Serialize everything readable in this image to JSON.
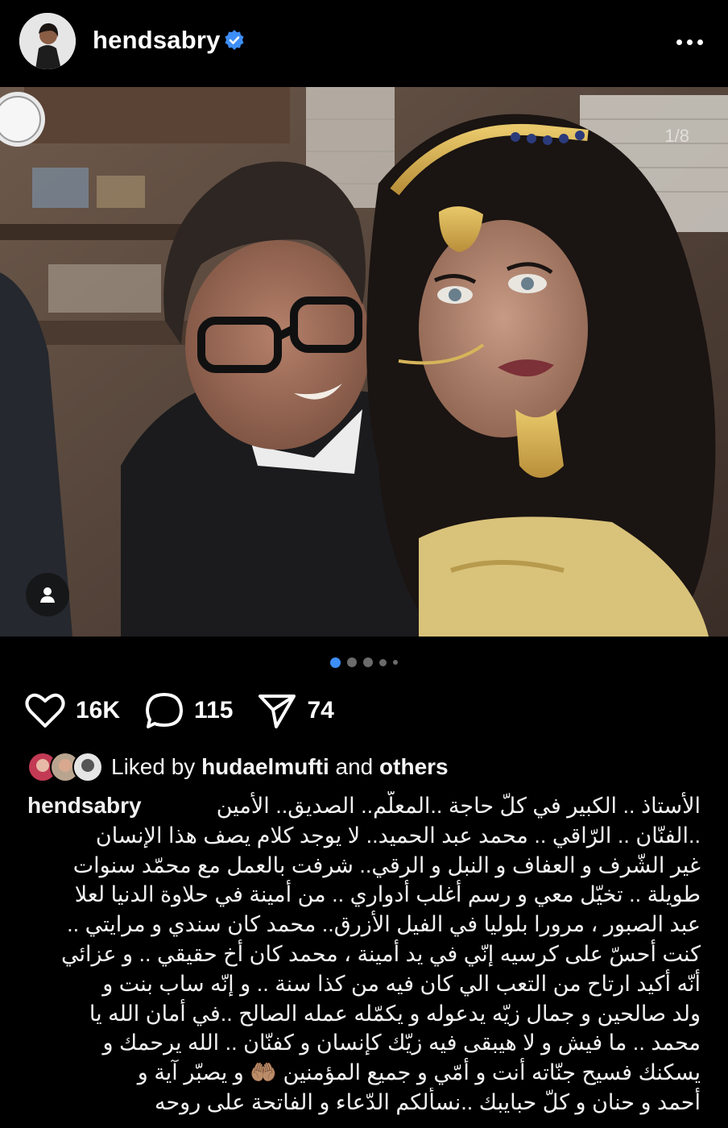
{
  "post": {
    "username": "hendsabry",
    "verified_icon": "verified-badge-icon",
    "more_icon": "more-options-icon",
    "image_counter": "1/8",
    "carousel_dots": 5,
    "carousel_active_index": 0
  },
  "actions": {
    "likes_count": "16K",
    "comments_count": "115",
    "shares_count": "74"
  },
  "liked_by": {
    "prefix": "Liked by",
    "user": "hudaelmufti",
    "conjunction": "and",
    "others": "others"
  },
  "caption": {
    "username": "hendsabry",
    "lines": [
      "الأستاذ .. الكبير في كلّ حاجة ..المعلّم.. الصديق.. الأمين",
      "..الفنّان .. الرّاقي .. محمد عبد الحميد.. لا يوجد كلام يصف هذا الإنسان",
      "غير الشّرف و العفاف و النبل و الرقي.. شرفت بالعمل مع محمّد سنوات",
      "طويلة .. تخيّل معي و رسم أغلب أدواري .. من أمينة في حلاوة الدنيا لعلا",
      "عبد الصبور ، مرورا بلوليا في الفيل الأزرق.. محمد كان سندي و مرايتي ..",
      "كنت أحسّ على كرسيه إنّي في يد أمينة ، محمد كان أخ حقيقي .. و عزائي",
      "أنّه أكيد ارتاح من التعب الي كان فيه من كذا سنة .. و إنّه ساب بنت و",
      "ولد صالحين و جمال زيّه يدعوله و يكمّله عمله الصالح ..في أمان الله يا",
      "محمد .. ما فيش و لا هيبقى فيه زيّك كإنسان و كفنّان .. الله يرحمك و",
      "يسكنك فسيح جنّاته أنت و أمّي و جميع المؤمنين 🤲🏽 و يصبّر آية و",
      "أحمد و حنان و كلّ حبايبك ..نسألكم الدّعاء و الفاتحة على روحه"
    ]
  },
  "colors": {
    "background": "#000000",
    "text": "#f5f5f5",
    "verified": "#3d8ef8",
    "dot_active": "#3d8ef8",
    "dot_inactive": "#6b6b6b"
  }
}
